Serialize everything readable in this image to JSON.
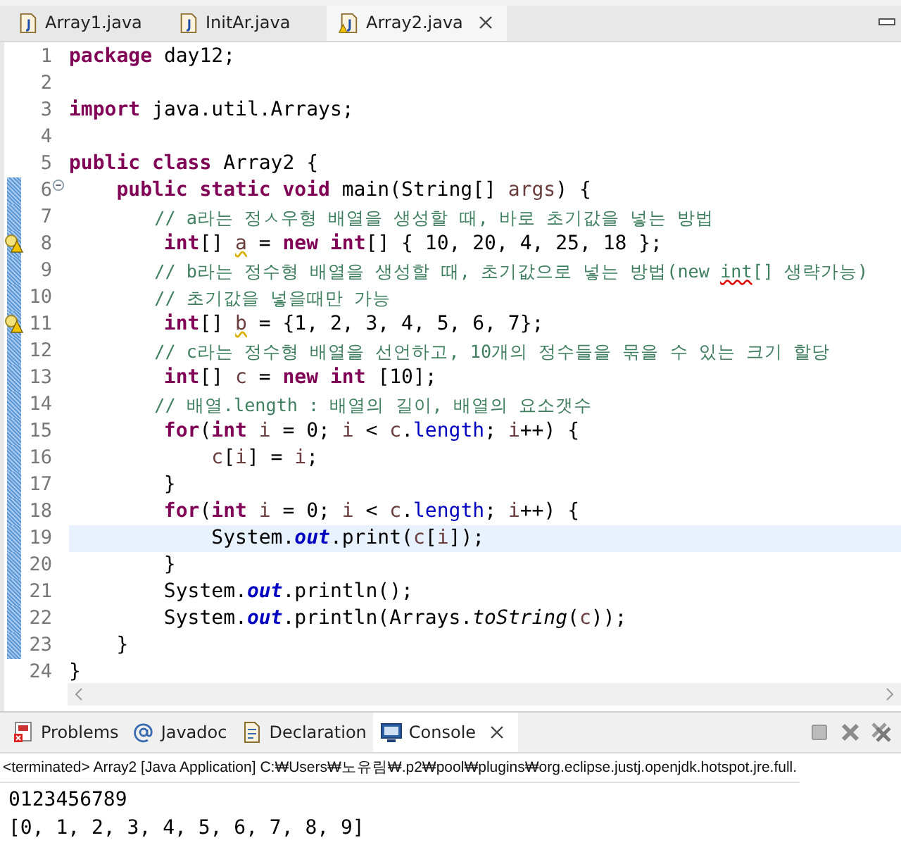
{
  "editor_tabs": [
    {
      "label": "Array1.java",
      "selected": false,
      "warning": false,
      "closable": false
    },
    {
      "label": "InitAr.java",
      "selected": false,
      "warning": false,
      "closable": false
    },
    {
      "label": "Array2.java",
      "selected": true,
      "warning": true,
      "closable": true
    }
  ],
  "editor": {
    "lines": [
      {
        "number": "1",
        "warning": false,
        "fold": false,
        "changed": false,
        "current": false,
        "tokens": [
          {
            "t": "package ",
            "kind": "keyword"
          },
          {
            "t": "day12;",
            "kind": "text"
          }
        ]
      },
      {
        "number": "2",
        "warning": false,
        "fold": false,
        "changed": false,
        "current": false
      },
      {
        "number": "3",
        "warning": false,
        "fold": false,
        "changed": false,
        "current": false,
        "tokens": [
          {
            "t": "import ",
            "kind": "keyword"
          },
          {
            "t": "java.util.Arrays;",
            "kind": "text"
          }
        ]
      },
      {
        "number": "4",
        "warning": false,
        "fold": false,
        "changed": false,
        "current": false
      },
      {
        "number": "5",
        "warning": false,
        "fold": false,
        "changed": false,
        "current": false,
        "tokens": [
          {
            "t": "public class ",
            "kind": "keyword"
          },
          {
            "t": "Array2 {",
            "kind": "text"
          }
        ]
      },
      {
        "number": "6",
        "warning": false,
        "fold": true,
        "changed": true,
        "current": false,
        "tokens": [
          {
            "t": "    public static void ",
            "kind": "keyword"
          },
          {
            "t": "main(String[] ",
            "kind": "text"
          },
          {
            "t": "args",
            "kind": "param"
          },
          {
            "t": ") {",
            "kind": "text"
          }
        ]
      },
      {
        "number": "7",
        "warning": false,
        "fold": false,
        "changed": true,
        "current": false,
        "tokens": [
          {
            "t": "        // a라는 정ㅅ우형 배열을 생성할 때, 바로 초기값을 넣는 방법",
            "kind": "comment"
          }
        ]
      },
      {
        "number": "8",
        "warning": true,
        "fold": false,
        "changed": true,
        "current": false,
        "tokens": [
          {
            "t": "        int",
            "kind": "keyword"
          },
          {
            "t": "[] ",
            "kind": "text"
          },
          {
            "t": "a",
            "kind": "warned"
          },
          {
            "t": " = ",
            "kind": "text"
          },
          {
            "t": "new int",
            "kind": "keyword"
          },
          {
            "t": "[] { 10, 20, 4, 25, 18 };",
            "kind": "text"
          }
        ]
      },
      {
        "number": "9",
        "warning": false,
        "fold": false,
        "changed": true,
        "current": false,
        "tokens": [
          {
            "t": "        // b라는 정수형 배열을 생성할 때, 초기값으로 넣는 방법(new ",
            "kind": "comment"
          },
          {
            "t": "int",
            "kind": "comment_spelling"
          },
          {
            "t": "[] 생략가능)",
            "kind": "comment"
          }
        ]
      },
      {
        "number": "10",
        "warning": false,
        "fold": false,
        "changed": true,
        "current": false,
        "tokens": [
          {
            "t": "        // 초기값을 넣을때만 가능",
            "kind": "comment"
          }
        ]
      },
      {
        "number": "11",
        "warning": true,
        "fold": false,
        "changed": true,
        "current": false,
        "tokens": [
          {
            "t": "        int",
            "kind": "keyword"
          },
          {
            "t": "[] ",
            "kind": "text"
          },
          {
            "t": "b",
            "kind": "warned"
          },
          {
            "t": " = {1, 2, 3, 4, 5, 6, 7};",
            "kind": "text"
          }
        ]
      },
      {
        "number": "12",
        "warning": false,
        "fold": false,
        "changed": true,
        "current": false,
        "tokens": [
          {
            "t": "        // c라는 정수형 배열을 선언하고, 10개의 정수들을 묶을 수 있는 크기 할당",
            "kind": "comment"
          }
        ]
      },
      {
        "number": "13",
        "warning": false,
        "fold": false,
        "changed": true,
        "current": false,
        "tokens": [
          {
            "t": "        int",
            "kind": "keyword"
          },
          {
            "t": "[] ",
            "kind": "text"
          },
          {
            "t": "c",
            "kind": "local"
          },
          {
            "t": " = ",
            "kind": "text"
          },
          {
            "t": "new int",
            "kind": "keyword"
          },
          {
            "t": " [10];",
            "kind": "text"
          }
        ]
      },
      {
        "number": "14",
        "warning": false,
        "fold": false,
        "changed": true,
        "current": false,
        "tokens": [
          {
            "t": "        // 배열.length : 배열의 길이, 배열의 요소갯수",
            "kind": "comment"
          }
        ]
      },
      {
        "number": "15",
        "warning": false,
        "fold": false,
        "changed": true,
        "current": false,
        "tokens": [
          {
            "t": "        for",
            "kind": "keyword"
          },
          {
            "t": "(",
            "kind": "text"
          },
          {
            "t": "int ",
            "kind": "keyword"
          },
          {
            "t": "i",
            "kind": "local"
          },
          {
            "t": " = 0; ",
            "kind": "text"
          },
          {
            "t": "i",
            "kind": "local"
          },
          {
            "t": " < ",
            "kind": "text"
          },
          {
            "t": "c",
            "kind": "local"
          },
          {
            "t": ".",
            "kind": "text"
          },
          {
            "t": "length",
            "kind": "field"
          },
          {
            "t": "; ",
            "kind": "text"
          },
          {
            "t": "i",
            "kind": "local"
          },
          {
            "t": "++) {",
            "kind": "text"
          }
        ]
      },
      {
        "number": "16",
        "warning": false,
        "fold": false,
        "changed": true,
        "current": false,
        "tokens": [
          {
            "t": "            c",
            "kind": "local"
          },
          {
            "t": "[",
            "kind": "text"
          },
          {
            "t": "i",
            "kind": "local"
          },
          {
            "t": "] = ",
            "kind": "text"
          },
          {
            "t": "i",
            "kind": "local"
          },
          {
            "t": ";",
            "kind": "text"
          }
        ]
      },
      {
        "number": "17",
        "warning": false,
        "fold": false,
        "changed": true,
        "current": false,
        "tokens": [
          {
            "t": "        }",
            "kind": "text"
          }
        ]
      },
      {
        "number": "18",
        "warning": false,
        "fold": false,
        "changed": true,
        "current": false,
        "tokens": [
          {
            "t": "        for",
            "kind": "keyword"
          },
          {
            "t": "(",
            "kind": "text"
          },
          {
            "t": "int ",
            "kind": "keyword"
          },
          {
            "t": "i",
            "kind": "local"
          },
          {
            "t": " = 0; ",
            "kind": "text"
          },
          {
            "t": "i",
            "kind": "local"
          },
          {
            "t": " < ",
            "kind": "text"
          },
          {
            "t": "c",
            "kind": "local"
          },
          {
            "t": ".",
            "kind": "text"
          },
          {
            "t": "length",
            "kind": "field"
          },
          {
            "t": "; ",
            "kind": "text"
          },
          {
            "t": "i",
            "kind": "local"
          },
          {
            "t": "++) {",
            "kind": "text"
          }
        ]
      },
      {
        "number": "19",
        "warning": false,
        "fold": false,
        "changed": true,
        "current": true,
        "tokens": [
          {
            "t": "            System.",
            "kind": "text"
          },
          {
            "t": "out",
            "kind": "static_field"
          },
          {
            "t": ".print(",
            "kind": "text"
          },
          {
            "t": "c",
            "kind": "local"
          },
          {
            "t": "[",
            "kind": "text"
          },
          {
            "t": "i",
            "kind": "local"
          },
          {
            "t": "]);",
            "kind": "text"
          }
        ]
      },
      {
        "number": "20",
        "warning": false,
        "fold": false,
        "changed": true,
        "current": false,
        "tokens": [
          {
            "t": "        }",
            "kind": "text"
          }
        ]
      },
      {
        "number": "21",
        "warning": false,
        "fold": false,
        "changed": true,
        "current": false,
        "tokens": [
          {
            "t": "        System.",
            "kind": "text"
          },
          {
            "t": "out",
            "kind": "static_field"
          },
          {
            "t": ".println();",
            "kind": "text"
          }
        ]
      },
      {
        "number": "22",
        "warning": false,
        "fold": false,
        "changed": true,
        "current": false,
        "tokens": [
          {
            "t": "        System.",
            "kind": "text"
          },
          {
            "t": "out",
            "kind": "static_field"
          },
          {
            "t": ".println(Arrays.",
            "kind": "text"
          },
          {
            "t": "toString",
            "kind": "static_method"
          },
          {
            "t": "(",
            "kind": "text"
          },
          {
            "t": "c",
            "kind": "local"
          },
          {
            "t": "));",
            "kind": "text"
          }
        ]
      },
      {
        "number": "23",
        "warning": false,
        "fold": false,
        "changed": true,
        "current": false,
        "tokens": [
          {
            "t": "    }",
            "kind": "text"
          }
        ]
      },
      {
        "number": "24",
        "warning": false,
        "fold": false,
        "changed": false,
        "current": false,
        "tokens": [
          {
            "t": "}",
            "kind": "text"
          }
        ]
      }
    ]
  },
  "bottom_tabs": [
    {
      "label": "Problems",
      "selected": false,
      "closable": false
    },
    {
      "label": "Javadoc",
      "selected": false,
      "closable": false
    },
    {
      "label": "Declaration",
      "selected": false,
      "closable": false
    },
    {
      "label": "Console",
      "selected": true,
      "closable": true
    }
  ],
  "console": {
    "status": "<terminated> Array2 [Java Application] C:₩Users₩노유림₩.p2₩pool₩plugins₩org.eclipse.justj.openjdk.hotspot.jre.full.",
    "output": [
      "0123456789",
      "[0, 1, 2, 3, 4, 5, 6, 7, 8, 9]"
    ]
  }
}
